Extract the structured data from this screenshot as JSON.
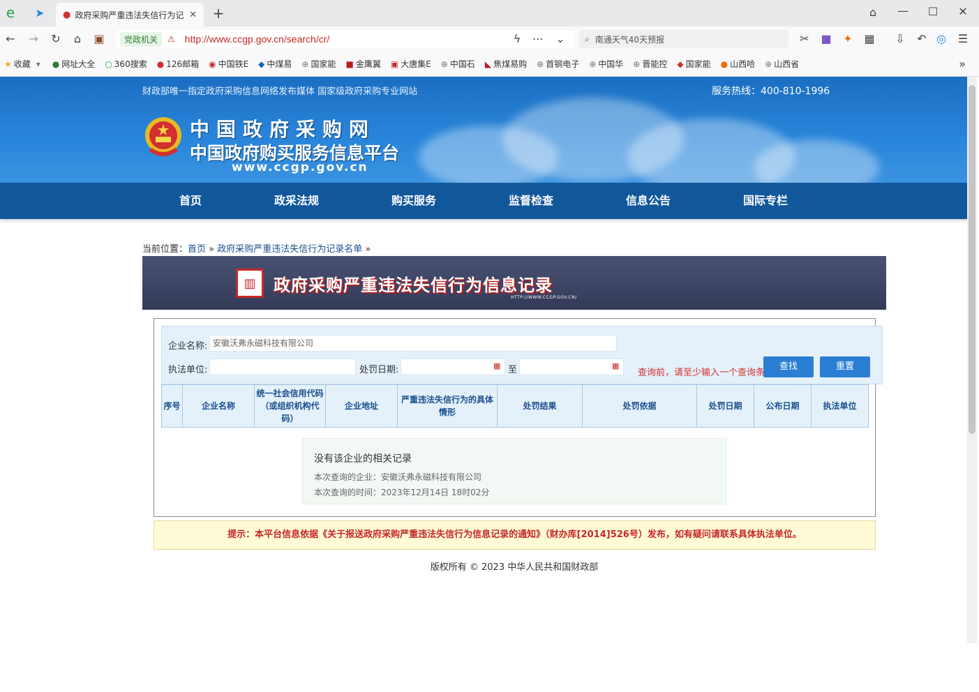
{
  "browser": {
    "tab_title": "政府采购严重违法失信行为记",
    "url_badge": "党政机关",
    "url": "http://www.ccgp.gov.cn/search/cr/",
    "search_text": "南通天气40天预报",
    "bookmarks": [
      "收藏",
      "网址大全",
      "360搜索",
      "126邮箱",
      "中国铁E",
      "中煤易",
      "国家能",
      "金鹰翼",
      "大唐集E",
      "中国石",
      "焦煤易购",
      "首钢电子",
      "中国华",
      "晋能控",
      "国家能",
      "山西哈",
      "山西省"
    ]
  },
  "header": {
    "top_line": "财政部唯一指定政府采购信息网络发布媒体 国家级政府采购专业网站",
    "hotline": "服务热线：400-810-1996",
    "site_name": "中国政府采购网",
    "site_subtitle": "中国政府购买服务信息平台",
    "site_url": "www.ccgp.gov.cn"
  },
  "nav": [
    "首页",
    "政采法规",
    "购买服务",
    "监督检查",
    "信息公告",
    "国际专栏"
  ],
  "breadcrumb": {
    "prefix": "当前位置：",
    "home": "首页",
    "sep": " » ",
    "current": "政府采购严重违法失信行为记录名单",
    "tail": " »"
  },
  "credit_banner": {
    "title": "政府采购严重违法失信行为信息记录",
    "url": "HTTP://WWW.CCGP.GOV.CN/"
  },
  "form": {
    "company_label": "企业名称:",
    "company_value": "安徽沃弗永磁科技有限公司",
    "agency_label": "执法单位:",
    "agency_value": "",
    "date_label": "处罚日期:",
    "to_label": "至",
    "hint": "查询前，请至少输入一个查询条件",
    "search_btn": "查找",
    "reset_btn": "重置"
  },
  "table": {
    "headers": [
      "序号",
      "企业名称",
      "统一社会信用代码（或组织机构代码）",
      "企业地址",
      "严重违法失信行为的具体情形",
      "处罚结果",
      "处罚依据",
      "处罚日期",
      "公布日期",
      "执法单位"
    ]
  },
  "empty": {
    "title": "没有该企业的相关记录",
    "company": "本次查询的企业：安徽沃弗永磁科技有限公司",
    "time": "本次查询的时间：2023年12月14日 18时02分"
  },
  "notice": "提示：本平台信息依据《关于报送政府采购严重违法失信行为信息记录的通知》（财办库[2014]526号）发布，如有疑问请联系具体执法单位。",
  "footer": "版权所有 © 2023 中华人民共和国财政部"
}
